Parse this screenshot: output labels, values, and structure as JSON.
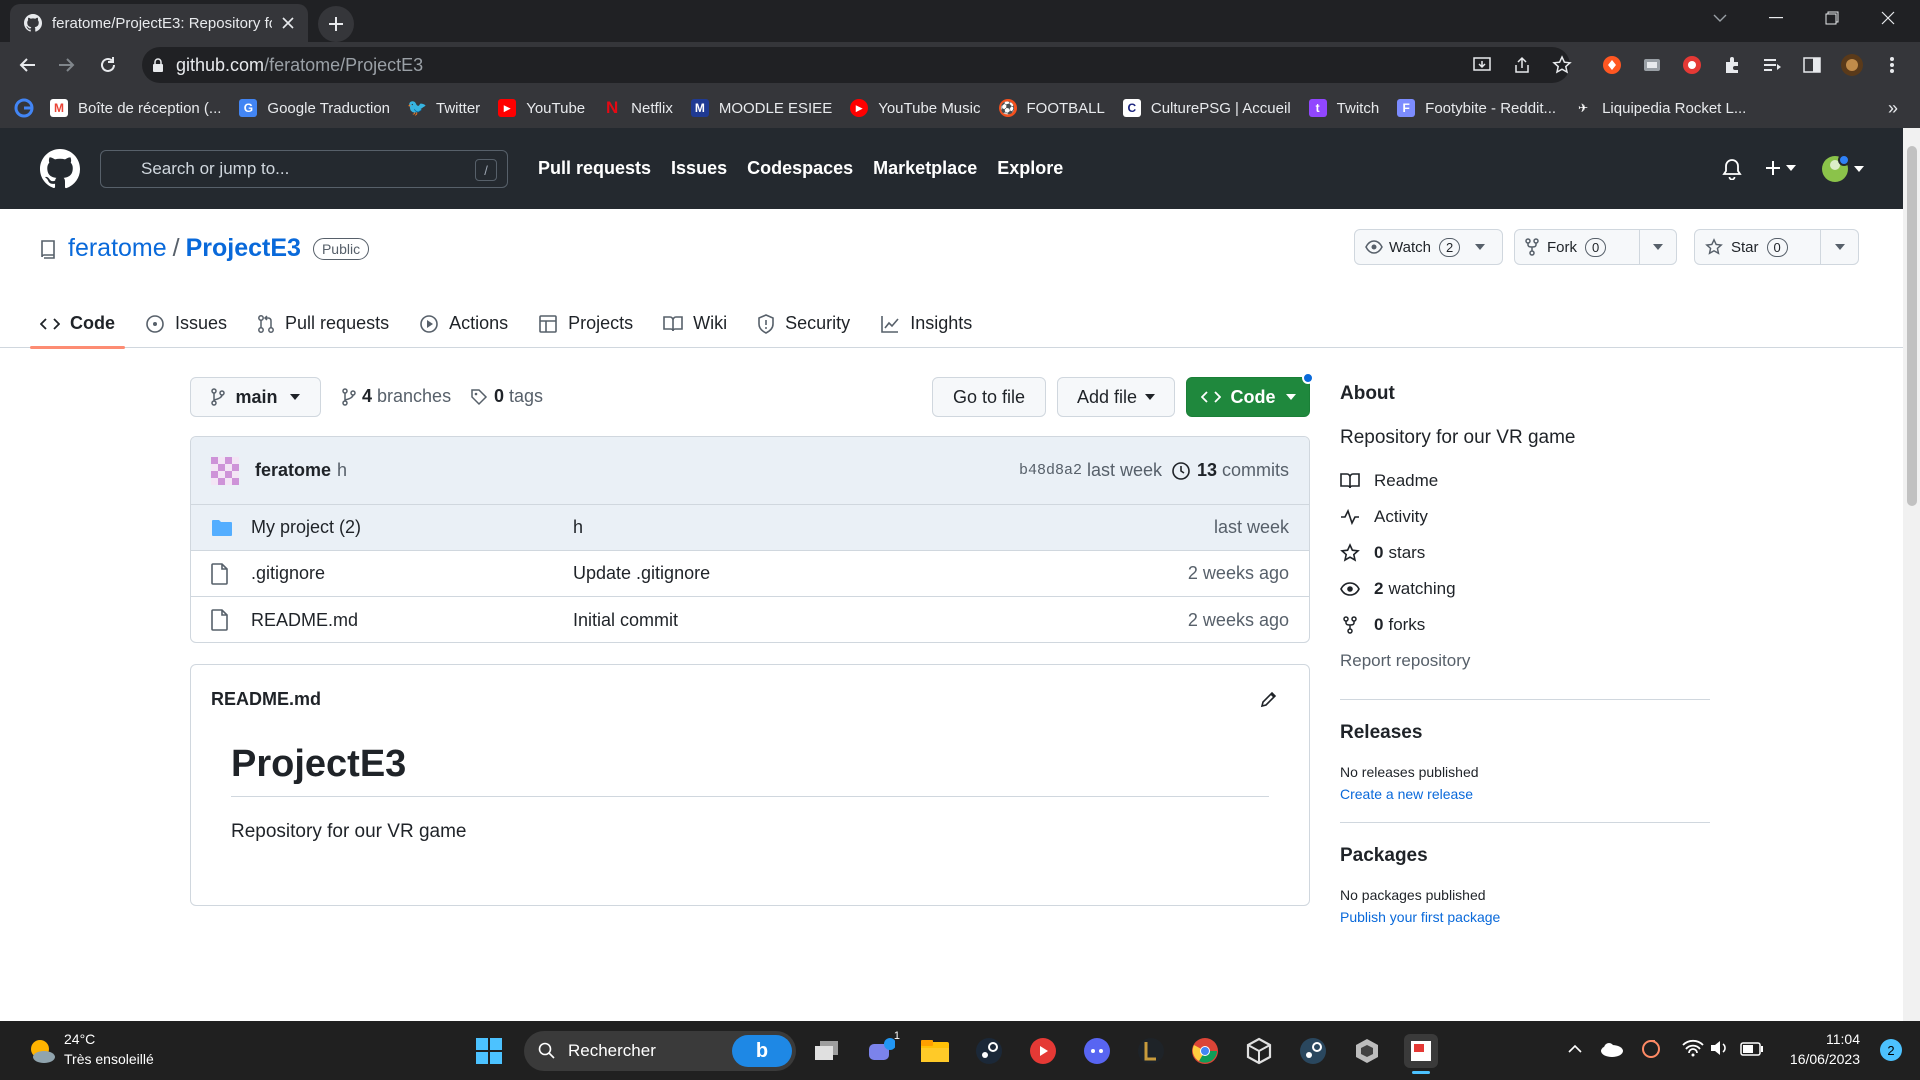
{
  "browser": {
    "tab_title": "feratome/ProjectE3: Repository fo",
    "url_host": "github.com",
    "url_path": "/feratome/ProjectE3"
  },
  "bookmarks": [
    {
      "label": "Boîte de réception (...",
      "icon": "gmail-icon",
      "color": "#ea4335"
    },
    {
      "label": "Google Traduction",
      "icon": "translate-icon",
      "color": "#4285f4"
    },
    {
      "label": "Twitter",
      "icon": "twitter-icon",
      "color": "#1d9bf0"
    },
    {
      "label": "YouTube",
      "icon": "youtube-icon",
      "color": "#ff0000"
    },
    {
      "label": "Netflix",
      "icon": "netflix-icon",
      "color": "#e50914"
    },
    {
      "label": "MOODLE ESIEE",
      "icon": "moodle-icon",
      "color": "#1f3a93"
    },
    {
      "label": "YouTube Music",
      "icon": "youtube-music-icon",
      "color": "#ff0000"
    },
    {
      "label": "FOOTBALL",
      "icon": "football-icon",
      "color": "#f4511e"
    },
    {
      "label": "CulturePSG | Accueil",
      "icon": "culturepsg-icon",
      "color": "#e8eaed"
    },
    {
      "label": "Twitch",
      "icon": "twitch-icon",
      "color": "#9146ff"
    },
    {
      "label": "Footybite - Reddit...",
      "icon": "footybite-icon",
      "color": "#7c8cff"
    },
    {
      "label": "Liquipedia Rocket L...",
      "icon": "liquipedia-icon",
      "color": "#e8eaed"
    }
  ],
  "github": {
    "search_placeholder": "Search or jump to...",
    "slash": "/",
    "nav": [
      "Pull requests",
      "Issues",
      "Codespaces",
      "Marketplace",
      "Explore"
    ]
  },
  "repo": {
    "owner": "feratome",
    "sep": "/",
    "name": "ProjectE3",
    "visibility": "Public",
    "watch_label": "Watch",
    "watch_count": "2",
    "fork_label": "Fork",
    "fork_count": "0",
    "star_label": "Star",
    "star_count": "0",
    "tabs": [
      "Code",
      "Issues",
      "Pull requests",
      "Actions",
      "Projects",
      "Wiki",
      "Security",
      "Insights"
    ]
  },
  "toolbar": {
    "branch": "main",
    "branches_count": "4",
    "branches_label": "branches",
    "tags_count": "0",
    "tags_label": "tags",
    "goto_file": "Go to file",
    "add_file": "Add file",
    "code": "Code"
  },
  "commit": {
    "author": "feratome",
    "message": "h",
    "sha": "b48d8a2",
    "when": "last week",
    "commits_count": "13",
    "commits_label": "commits"
  },
  "files": [
    {
      "name": "My project (2)",
      "message": "h",
      "age": "last week",
      "type": "folder"
    },
    {
      "name": ".gitignore",
      "message": "Update .gitignore",
      "age": "2 weeks ago",
      "type": "file"
    },
    {
      "name": "README.md",
      "message": "Initial commit",
      "age": "2 weeks ago",
      "type": "file"
    }
  ],
  "readme": {
    "filename": "README.md",
    "heading": "ProjectE3",
    "body": "Repository for our VR game"
  },
  "about": {
    "title": "About",
    "description": "Repository for our VR game",
    "readme": "Readme",
    "activity": "Activity",
    "stars_count": "0",
    "stars_label": "stars",
    "watching_count": "2",
    "watching_label": "watching",
    "forks_count": "0",
    "forks_label": "forks",
    "report": "Report repository"
  },
  "releases": {
    "title": "Releases",
    "empty": "No releases published",
    "link": "Create a new release"
  },
  "packages": {
    "title": "Packages",
    "empty": "No packages published",
    "link": "Publish your first package"
  },
  "taskbar": {
    "temp": "24°C",
    "weather": "Très ensoleillé",
    "search": "Rechercher",
    "time": "11:04",
    "date": "16/06/2023",
    "notif_count": "2",
    "chat_badge": "1"
  }
}
